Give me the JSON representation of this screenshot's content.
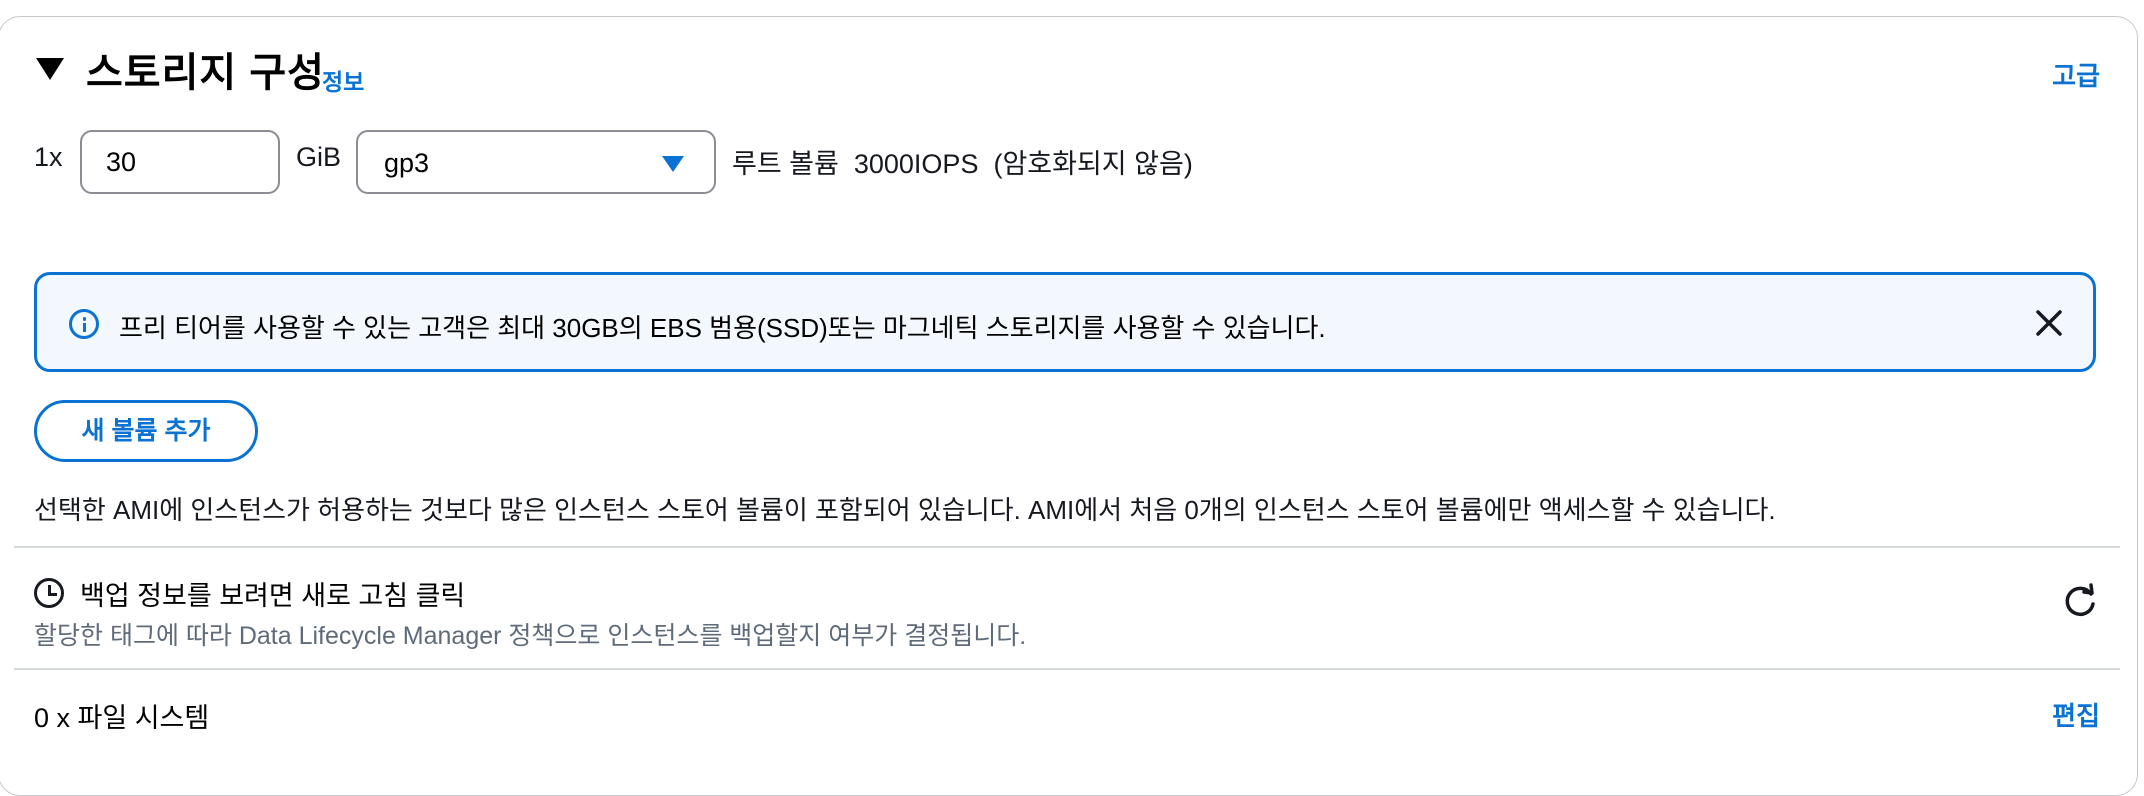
{
  "section": {
    "title": "스토리지 구성",
    "info_link": "정보",
    "advanced_link": "고급"
  },
  "volume": {
    "count_label": "1x",
    "size_value": "30",
    "size_unit": "GiB",
    "type_value": "gp3",
    "description": "루트 볼륨  3000IOPS  (암호화되지 않음)"
  },
  "alert": {
    "message": "프리 티어를 사용할 수 있는 고객은 최대 30GB의 EBS 범용(SSD)또는 마그네틱 스토리지를 사용할 수 있습니다."
  },
  "add_volume_button": "새 볼륨 추가",
  "ami_note": "선택한 AMI에 인스턴스가 허용하는 것보다 많은 인스턴스 스토어 볼륨이 포함되어 있습니다. AMI에서 처음 0개의 인스턴스 스토어 볼륨에만 액세스할 수 있습니다.",
  "backup": {
    "title": "백업 정보를 보려면 새로 고침 클릭",
    "subtitle": "할당한 태그에 따라 Data Lifecycle Manager 정책으로 인스턴스를 백업할지 여부가 결정됩니다."
  },
  "file_systems": {
    "label": "0 x 파일 시스템",
    "edit_link": "편집"
  },
  "icons": {
    "collapse": "caret-down-icon",
    "info": "info-circle-icon",
    "close": "close-icon",
    "clock": "clock-icon",
    "refresh": "refresh-icon",
    "dropdown": "dropdown-caret-icon"
  },
  "colors": {
    "accent": "#0972d3",
    "alert_bg": "#f2f8fd",
    "muted_text": "#5f6b7a"
  }
}
